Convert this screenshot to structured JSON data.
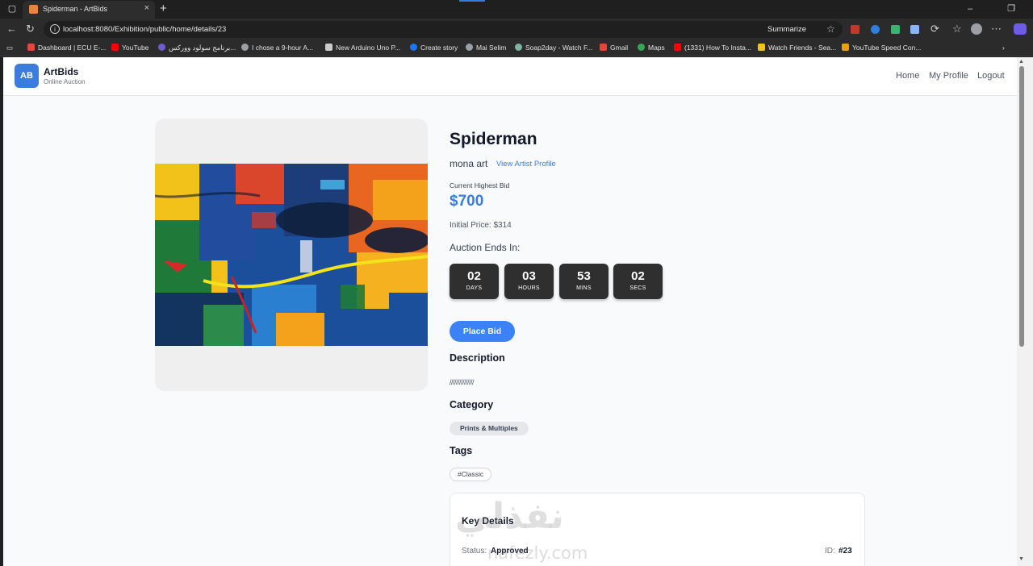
{
  "browser": {
    "tab_title": "Spiderman - ArtBids",
    "tab_close": "×",
    "new_tab": "+",
    "url": "localhost:8080/Exhibition/public/home/details/23",
    "summarize": "Summarize",
    "bookmarks": [
      {
        "label": "Dashboard | ECU E-...",
        "color": "#e04a3b"
      },
      {
        "label": "YouTube",
        "color": "#ff0000"
      },
      {
        "label": "برنامج سولود ووركس...",
        "color": "#6d5bd0"
      },
      {
        "label": "I chose a 9-hour A...",
        "color": "#9aa0a6"
      },
      {
        "label": "New Arduino Uno P...",
        "color": "#cccccc"
      },
      {
        "label": "Create story",
        "color": "#1877f2"
      },
      {
        "label": "Mai Selim",
        "color": "#9aa0a6"
      },
      {
        "label": "Soap2day - Watch F...",
        "color": "#7fb3a3"
      },
      {
        "label": "Gmail",
        "color": "#ea4335"
      },
      {
        "label": "Maps",
        "color": "#34a853"
      },
      {
        "label": "(1331) How To Insta...",
        "color": "#ff0000"
      },
      {
        "label": "Watch Friends - Sea...",
        "color": "#f1c40f"
      },
      {
        "label": "YouTube Speed Con...",
        "color": "#f39c12"
      }
    ]
  },
  "header": {
    "logo": "AB",
    "brand": "ArtBids",
    "tagline": "Online Auction",
    "nav": [
      "Home",
      "My Profile",
      "Logout"
    ]
  },
  "artwork": {
    "title": "Spiderman",
    "artist": "mona art",
    "artist_link": "View Artist Profile",
    "bid_label": "Current Highest Bid",
    "bid_value": "$700",
    "initial_price": "Initial Price: $314",
    "ends_label": "Auction Ends In:",
    "countdown": [
      {
        "value": "02",
        "unit": "DAYS"
      },
      {
        "value": "03",
        "unit": "HOURS"
      },
      {
        "value": "53",
        "unit": "MINS"
      },
      {
        "value": "02",
        "unit": "SECS"
      }
    ],
    "place_bid": "Place Bid",
    "description_heading": "Description",
    "description": "///////////////",
    "category_heading": "Category",
    "category": "Prints & Multiples",
    "tags_heading": "Tags",
    "tag": "#Classic"
  },
  "key_details": {
    "heading": "Key Details",
    "status_label": "Status:",
    "status_value": "Approved",
    "id_label": "ID:",
    "id_value": "#23"
  },
  "watermark": {
    "arabic": "نفذلي",
    "latin": "nafezly.com"
  }
}
